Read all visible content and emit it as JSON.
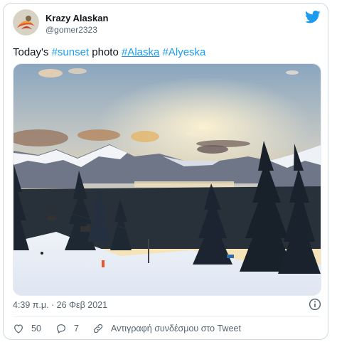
{
  "user": {
    "display_name": "Krazy Alaskan",
    "handle": "@gomer2323"
  },
  "tweet": {
    "prefix": "Today's ",
    "hashtag1": "#sunset",
    "middle": " photo ",
    "hashtag2": "#Alaska",
    "space": " ",
    "hashtag3": "#Alyeska"
  },
  "timestamp": "4:39 π.μ. · 26 Φεβ 2021",
  "actions": {
    "likes": "50",
    "replies": "7",
    "copy_link": "Αντιγραφή συνδέσμου στο Tweet"
  },
  "icons": {
    "brand": "twitter-bird-icon",
    "info": "info-icon",
    "like": "heart-icon",
    "reply": "reply-icon",
    "copy": "link-icon"
  },
  "colors": {
    "accent": "#1d9bf0",
    "secondary_text": "#536471",
    "border": "#cfd9de"
  }
}
